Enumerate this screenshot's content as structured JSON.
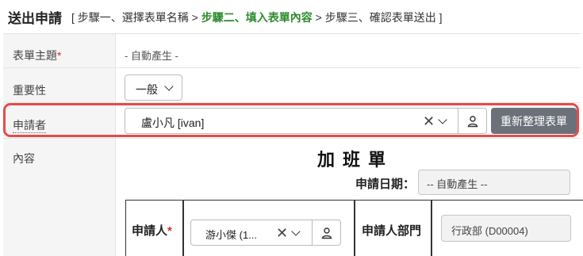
{
  "header": {
    "title": "送出申請",
    "steps_prefix": "[ 步驟一、選擇表單名稱 >",
    "steps_current": "步驟二、填入表單內容",
    "steps_suffix": "> 步驟三、確認表單送出 ]"
  },
  "form": {
    "subject": {
      "label": "表單主題",
      "required_mark": "*",
      "value": "- 自動產生 -"
    },
    "priority": {
      "label": "重要性",
      "value": "一般"
    },
    "applicant": {
      "label": "申請者",
      "value": "盧小凡 [ivan]",
      "clear_symbol": "✕"
    },
    "refresh_button": "重新整理表單",
    "content": {
      "label": "內容"
    }
  },
  "document": {
    "title": "加班單",
    "date_label": "申請日期：",
    "date_value": "-- 自動產生 --",
    "applicant_label": "申請人",
    "applicant_required": "*",
    "applicant_value": "游小傑 (1...",
    "clear_symbol": "✕",
    "dept_label": "申請人部門",
    "dept_value": "行政部 (D00004)"
  },
  "colors": {
    "highlight": "#e84a4a",
    "step_current": "#2e8b2e",
    "button": "#6b7079"
  }
}
